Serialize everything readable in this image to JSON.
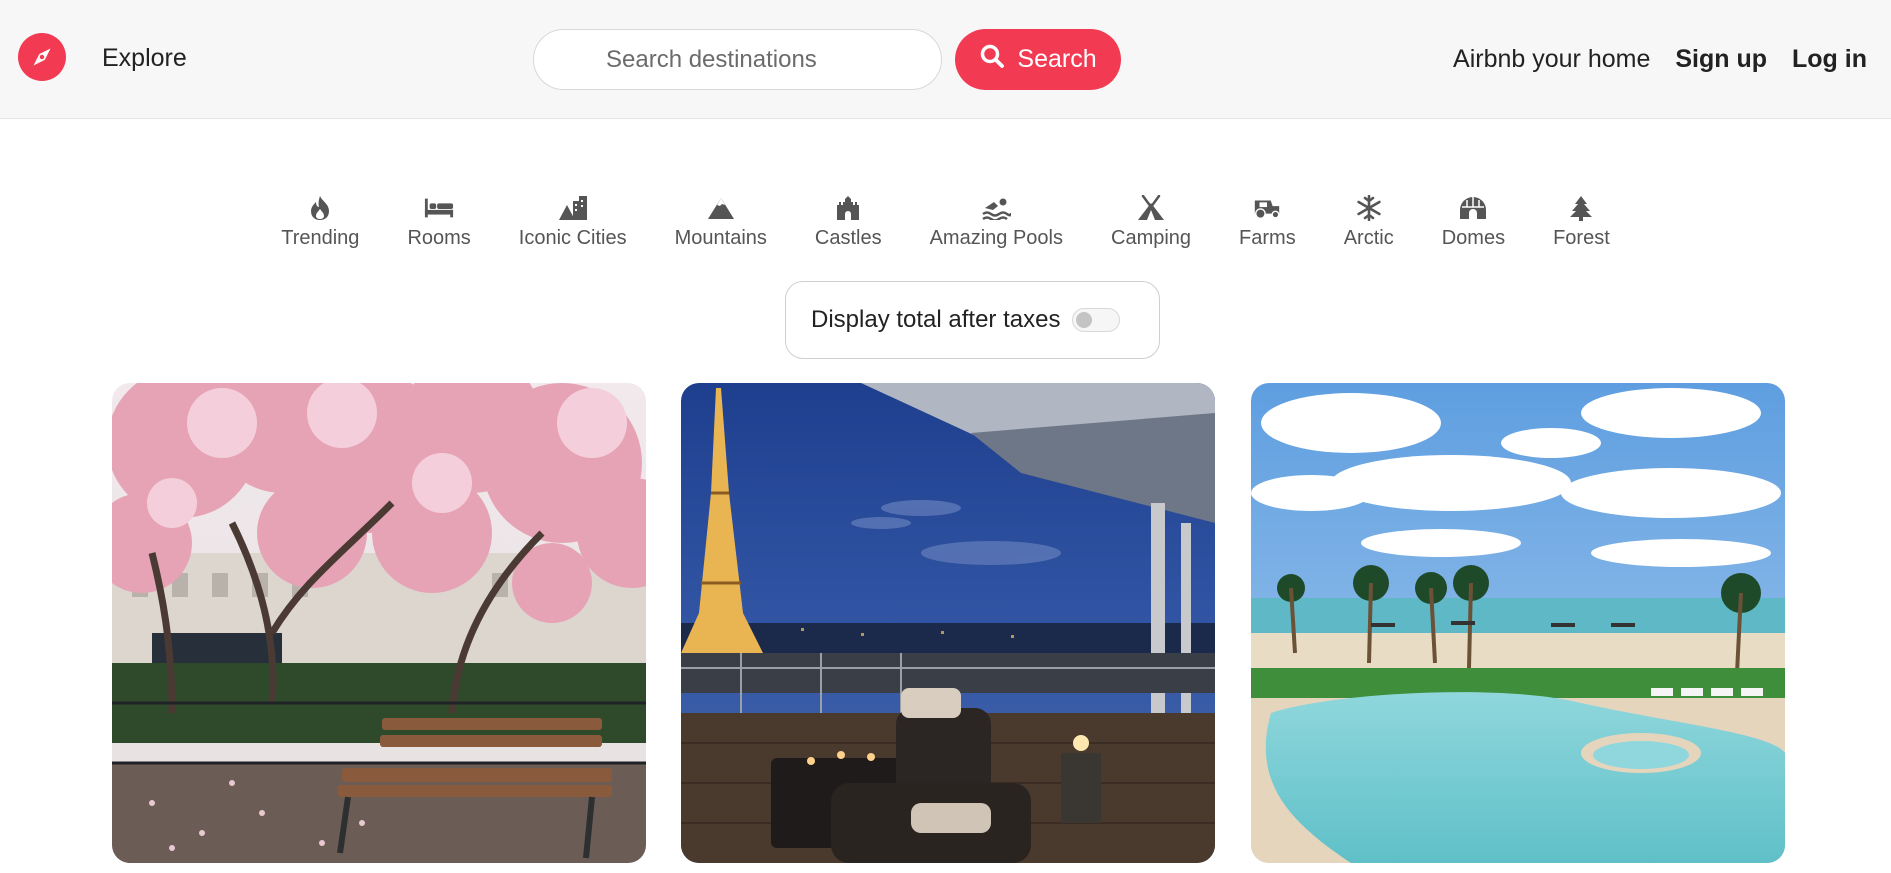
{
  "header": {
    "logo_icon": "compass-icon",
    "explore_label": "Explore",
    "search": {
      "placeholder": "Search destinations",
      "value": ""
    },
    "search_button_label": "Search",
    "host_label": "Airbnb your home",
    "signup_label": "Sign up",
    "login_label": "Log in",
    "brand_color": "#f23b52"
  },
  "categories": [
    {
      "label": "Trending",
      "icon": "flame-icon"
    },
    {
      "label": "Rooms",
      "icon": "bed-icon"
    },
    {
      "label": "Iconic Cities",
      "icon": "city-icon"
    },
    {
      "label": "Mountains",
      "icon": "mountain-icon"
    },
    {
      "label": "Castles",
      "icon": "castle-icon"
    },
    {
      "label": "Amazing Pools",
      "icon": "swimmer-icon"
    },
    {
      "label": "Camping",
      "icon": "tent-icon"
    },
    {
      "label": "Farms",
      "icon": "tractor-icon"
    },
    {
      "label": "Arctic",
      "icon": "snowflake-icon"
    },
    {
      "label": "Domes",
      "icon": "igloo-icon"
    },
    {
      "label": "Forest",
      "icon": "tree-icon"
    }
  ],
  "tax_toggle": {
    "label": "Display total after taxes",
    "enabled": false
  },
  "listings": [
    {
      "image": "cherry-blossom-park-bench"
    },
    {
      "image": "eiffel-tower-terrace-night"
    },
    {
      "image": "beach-resort-pool"
    }
  ]
}
